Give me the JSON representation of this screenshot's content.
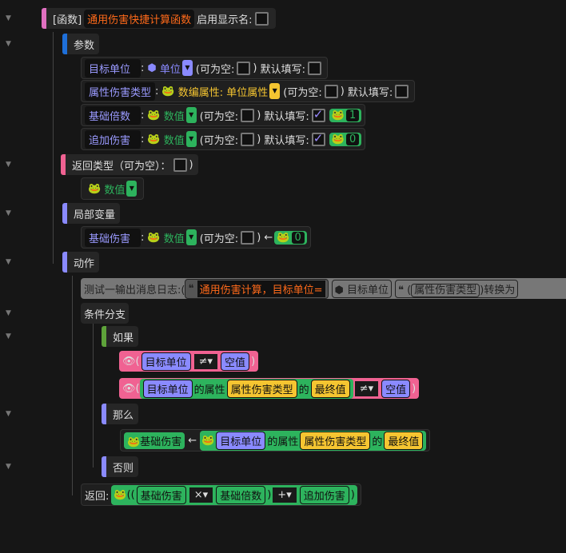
{
  "func": {
    "prefix": "[函数]",
    "name": "通用伤害快捷计算函数",
    "show_name_label": "启用显示名:"
  },
  "params": {
    "title": "参数",
    "items": [
      {
        "name": "目标单位",
        "type": "单位",
        "nullable": "(可为空:",
        "default": "默认填写:",
        "default_checked": false
      },
      {
        "name": "属性伤害类型",
        "type": "数编属性: 单位属性",
        "nullable": "(可为空:",
        "default": "默认填写:",
        "default_checked": false
      },
      {
        "name": "基础倍数",
        "type": "数值",
        "nullable": "(可为空:",
        "default": "默认填写:",
        "default_checked": true,
        "default_value": "1"
      },
      {
        "name": "追加伤害",
        "type": "数值",
        "nullable": "(可为空:",
        "default": "默认填写:",
        "default_checked": true,
        "default_value": "0"
      }
    ]
  },
  "return_type": {
    "title": "返回类型（可为空）：",
    "type": "数值"
  },
  "locals": {
    "title": "局部变量",
    "name": "基础伤害",
    "type": "数值",
    "nullable": "(可为空:",
    "arrow": "←",
    "value": "0"
  },
  "actions": {
    "title": "动作",
    "log": {
      "label": "测试一输出消息日志:(",
      "text": "通用伤害计算，目标单位=",
      "unit": "目标单位",
      "paren": "(",
      "attr": "属性伤害类型",
      "convert": ")转换为"
    },
    "branch": {
      "title": "条件分支",
      "if": "如果",
      "then": "那么",
      "else": "否则",
      "cond1": {
        "left": "目标单位",
        "op": "≠",
        "right": "空值"
      },
      "cond2": {
        "unit": "目标单位",
        "of_attr": "的属性",
        "attr": "属性伤害类型",
        "of": "的",
        "final": "最终值",
        "op": "≠",
        "right": "空值"
      },
      "assign": {
        "var": "基础伤害",
        "arrow": "←",
        "unit": "目标单位",
        "of_attr": "的属性",
        "attr": "属性伤害类型",
        "of": "的",
        "final": "最终值"
      }
    },
    "ret": {
      "label": "返回:",
      "a": "基础伤害",
      "op1": "×",
      "b": "基础倍数",
      "op2": "+",
      "c": "追加伤害"
    }
  },
  "colors": {
    "bg": "#161616",
    "pink": "#f06292",
    "blue": "#1e6fd9",
    "purple": "#8a8aff",
    "green": "#2db35d",
    "yellow": "#f5c531",
    "orange": "#ff6a1a"
  }
}
